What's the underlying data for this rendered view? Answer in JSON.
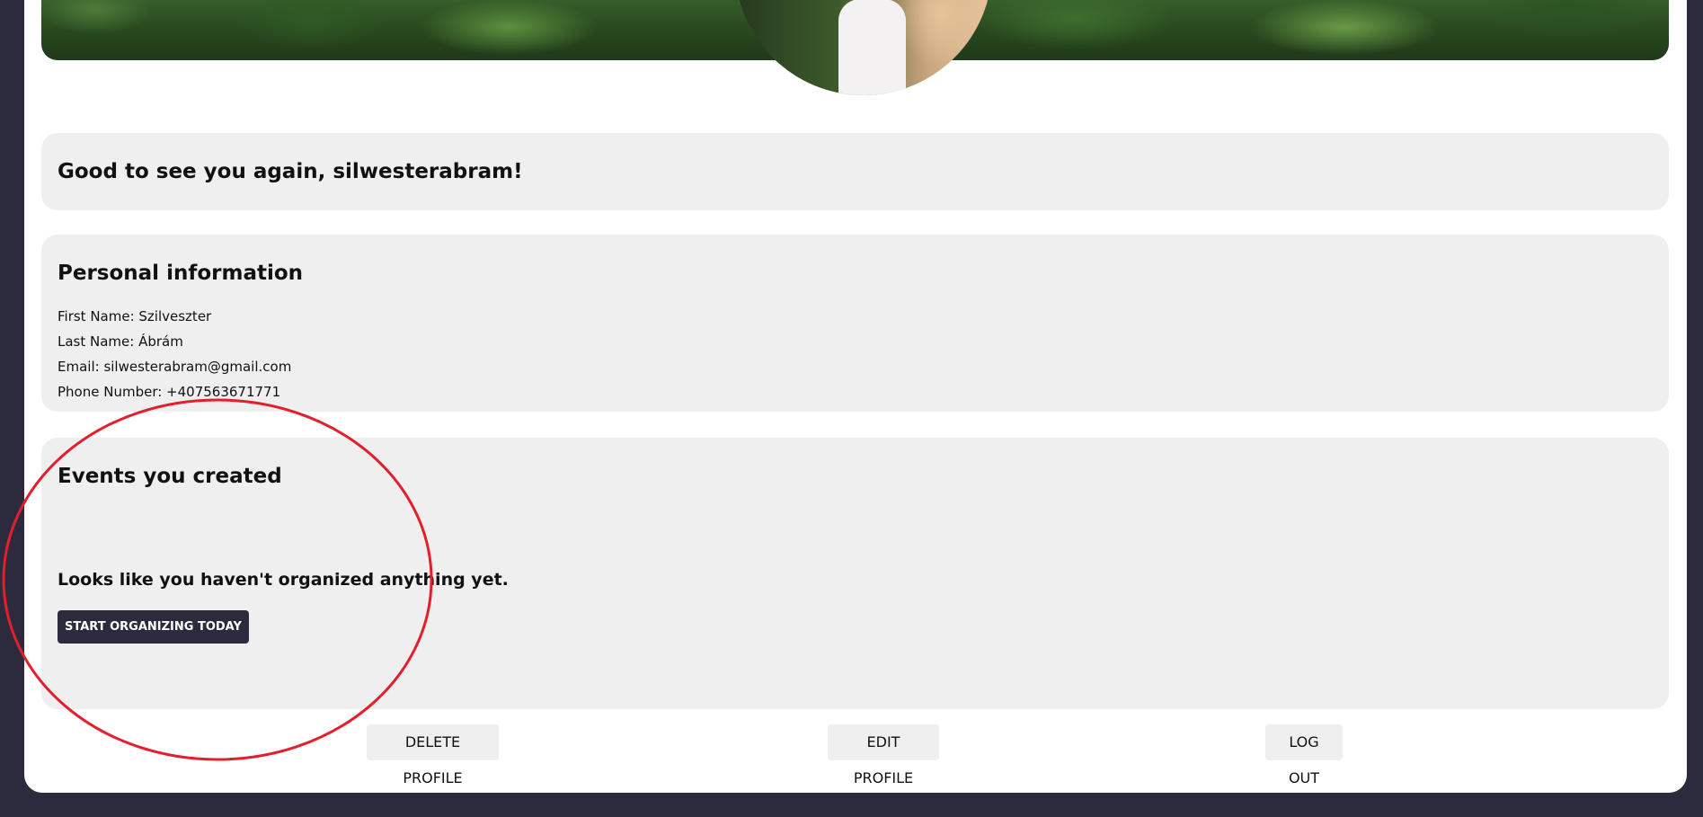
{
  "greeting": "Good to see you again, silwesterabram!",
  "personal_info": {
    "title": "Personal information",
    "first_name": "First Name: Szilveszter",
    "last_name": "Last Name: Ábrám",
    "email": "Email: silwesterabram@gmail.com",
    "phone": "Phone Number: +407563671771"
  },
  "events": {
    "title": "Events you created",
    "empty_message": "Looks like you haven't organized anything yet.",
    "start_button": "START ORGANIZING TODAY"
  },
  "actions": {
    "delete": "DELETE PROFILE",
    "edit": "EDIT PROFILE",
    "logout": "LOG OUT"
  },
  "colors": {
    "background": "#2c2b3d",
    "panel": "#efefef",
    "annotation": "#e21f2a"
  }
}
